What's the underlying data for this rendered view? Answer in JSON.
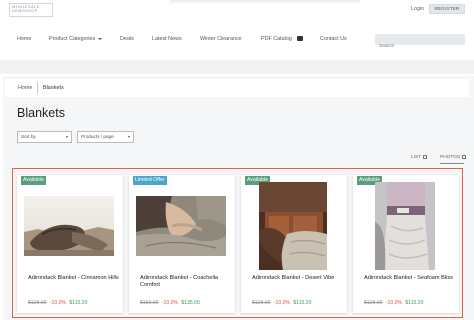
{
  "header": {
    "logo_line1": "WHOLESALE",
    "logo_line2": "DEMOSHOP",
    "login": "Login",
    "register": "REGISTER"
  },
  "nav": {
    "items": [
      "Home",
      "Product Categories",
      "Deals",
      "Latest News",
      "Winter Clearance",
      "PDF Catalog",
      "Contact Us"
    ],
    "search_placeholder": "Search"
  },
  "breadcrumb": {
    "home": "Home",
    "current": "Blankets"
  },
  "page": {
    "title": "Blankets",
    "sort_label": "Sort by",
    "per_page_label": "Products / page",
    "view_list": "LIST",
    "view_photos": "PHOTOS"
  },
  "colors": {
    "badge_available": "#5a9e7c",
    "badge_limited": "#4aa5c8",
    "frame": "#e2604a",
    "price_new": "#3a9a5a",
    "price_discount": "#d9534f"
  },
  "products": [
    {
      "badge": "Available",
      "title": "Adirondack Blanket - Cinnamon Hills",
      "old_price": "$128.00",
      "discount": "-10.0%",
      "new_price": "$115.20"
    },
    {
      "badge": "Limited Offer",
      "title": "Adirondack Blanket - Coachella Comfort",
      "old_price": "$150.00",
      "discount": "-10.0%",
      "new_price": "$135.00"
    },
    {
      "badge": "Available",
      "title": "Adirondack Blanket - Desert Vibe",
      "old_price": "$128.00",
      "discount": "-10.0%",
      "new_price": "$115.20"
    },
    {
      "badge": "Available",
      "title": "Adirondack Blanket - Seafoam Bliss",
      "old_price": "$128.00",
      "discount": "-10.0%",
      "new_price": "$115.20"
    }
  ]
}
